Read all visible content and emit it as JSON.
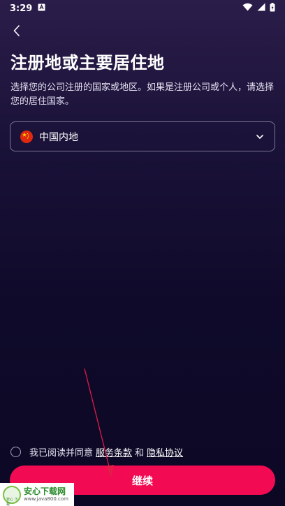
{
  "status_bar": {
    "time": "3:29",
    "notification_icon": "a-icon",
    "wifi_icon": "wifi-icon",
    "signal_icon": "signal-icon",
    "battery_icon": "battery-charging-icon"
  },
  "header": {
    "back_icon": "chevron-left-icon",
    "title": "注册地或主要居住地"
  },
  "description": "选择您的公司注册的国家或地区。如果是注册公司或个人，请选择您的居住国家。",
  "country_select": {
    "flag_icon": "china-flag-icon",
    "selected": "中国内地",
    "chevron_icon": "chevron-down-icon"
  },
  "agreement": {
    "prefix": "我已阅读并同意",
    "terms_link": "服务条款",
    "and": "和",
    "privacy_link": "隐私协议"
  },
  "continue_label": "继续",
  "watermark": {
    "title": "安心下载网",
    "url": "www.java800.com",
    "logo_text": "安心 下载"
  },
  "colors": {
    "accent": "#f20a52",
    "background": "#0f0a2a",
    "border": "#7e7798",
    "annotation_arrow": "#e11d48"
  }
}
